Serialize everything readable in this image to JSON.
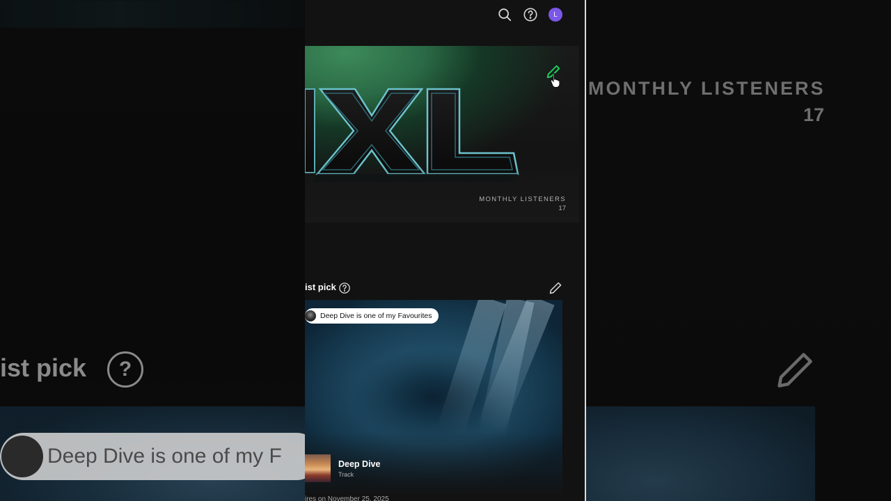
{
  "background": {
    "pick_text": "ist pick",
    "chip_text": "Deep Dive is one of my F",
    "listeners_label": "MONTHLY LISTENERS",
    "listeners_count": "17"
  },
  "topbar": {
    "icons": [
      "search-icon",
      "help-icon",
      "avatar"
    ],
    "avatar_initial": "L",
    "avatar_color": "#7b57e8"
  },
  "header": {
    "logo_text": "XL",
    "monthly_listeners_label": "MONTHLY LISTENERS",
    "monthly_listeners_count": "17",
    "edit_icon_color": "#1ed760"
  },
  "artist_pick": {
    "title": "ist pick",
    "chip_text": "Deep Dive is one of my Favourites",
    "track_name": "Deep Dive",
    "track_type": "Track",
    "expiry_text": "ires on November 25, 2025"
  }
}
